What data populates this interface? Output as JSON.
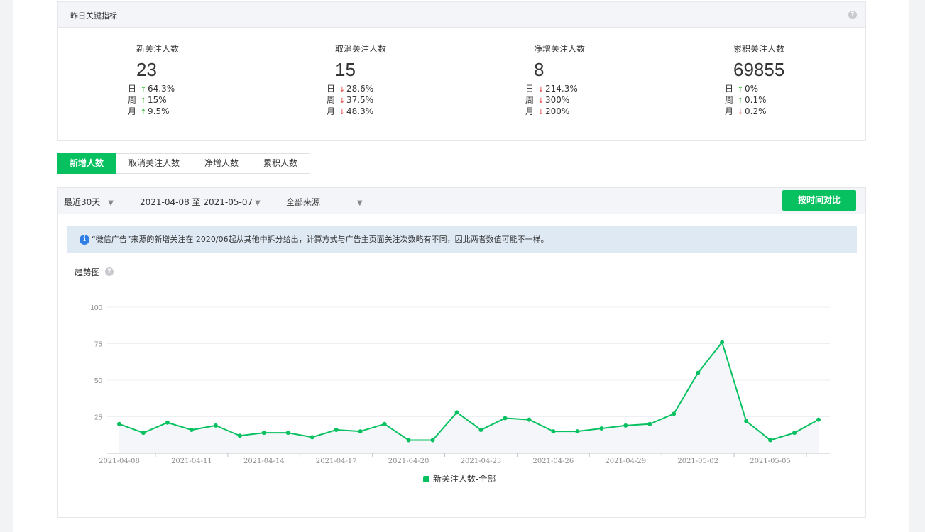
{
  "kpi": {
    "title": "昨日关键指标",
    "cards": [
      {
        "label": "新关注人数",
        "value": "23",
        "rows": [
          {
            "period": "日",
            "dir": "up",
            "pct": "64.3%"
          },
          {
            "period": "周",
            "dir": "up",
            "pct": "15%"
          },
          {
            "period": "月",
            "dir": "up",
            "pct": "9.5%"
          }
        ]
      },
      {
        "label": "取消关注人数",
        "value": "15",
        "rows": [
          {
            "period": "日",
            "dir": "down",
            "pct": "28.6%"
          },
          {
            "period": "周",
            "dir": "down",
            "pct": "37.5%"
          },
          {
            "period": "月",
            "dir": "down",
            "pct": "48.3%"
          }
        ]
      },
      {
        "label": "净增关注人数",
        "value": "8",
        "rows": [
          {
            "period": "日",
            "dir": "down",
            "pct": "214.3%"
          },
          {
            "period": "周",
            "dir": "down",
            "pct": "300%"
          },
          {
            "period": "月",
            "dir": "down",
            "pct": "200%"
          }
        ]
      },
      {
        "label": "累积关注人数",
        "value": "69855",
        "rows": [
          {
            "period": "日",
            "dir": "up",
            "pct": "0%"
          },
          {
            "period": "周",
            "dir": "up",
            "pct": "0.1%"
          },
          {
            "period": "月",
            "dir": "down",
            "pct": "0.2%"
          }
        ]
      }
    ]
  },
  "tabs": [
    "新增人数",
    "取消关注人数",
    "净增人数",
    "累积人数"
  ],
  "filters": {
    "range": "最近30天",
    "dates": "2021-04-08 至 2021-05-07",
    "source": "全部来源",
    "compare_button": "按时间对比"
  },
  "notice": "“微信广告”来源的新增关注在 2020/06起从其他中拆分给出，计算方式与广告主页面关注次数略有不同，因此两者数值可能不一样。",
  "trend_title": "趋势图",
  "colors": {
    "accent": "#07c160",
    "up": "#1aad19",
    "down": "#e64340",
    "info": "#2f7ee6"
  },
  "icons": {
    "help": "question-circle-icon",
    "info": "info-circle-icon",
    "caret": "triangle-down-icon"
  },
  "chart_data": {
    "type": "area",
    "ylim": [
      0,
      100
    ],
    "yticks": [
      25,
      50,
      75,
      100
    ],
    "x": [
      "2021-04-08",
      "2021-04-09",
      "2021-04-10",
      "2021-04-11",
      "2021-04-12",
      "2021-04-13",
      "2021-04-14",
      "2021-04-15",
      "2021-04-16",
      "2021-04-17",
      "2021-04-18",
      "2021-04-19",
      "2021-04-20",
      "2021-04-21",
      "2021-04-22",
      "2021-04-23",
      "2021-04-24",
      "2021-04-25",
      "2021-04-26",
      "2021-04-27",
      "2021-04-28",
      "2021-04-29",
      "2021-04-30",
      "2021-05-01",
      "2021-05-02",
      "2021-05-03",
      "2021-05-04",
      "2021-05-05",
      "2021-05-06",
      "2021-05-07"
    ],
    "xtick_labels": [
      "2021-04-08",
      "2021-04-11",
      "2021-04-14",
      "2021-04-17",
      "2021-04-20",
      "2021-04-23",
      "2021-04-26",
      "2021-04-29",
      "2021-05-02",
      "2021-05-05"
    ],
    "series": [
      {
        "name": "新关注人数-全部",
        "values": [
          20,
          14,
          21,
          16,
          19,
          12,
          14,
          14,
          11,
          16,
          15,
          20,
          9,
          9,
          28,
          16,
          24,
          23,
          15,
          15,
          17,
          19,
          20,
          27,
          55,
          76,
          22,
          9,
          14,
          23
        ]
      }
    ]
  }
}
